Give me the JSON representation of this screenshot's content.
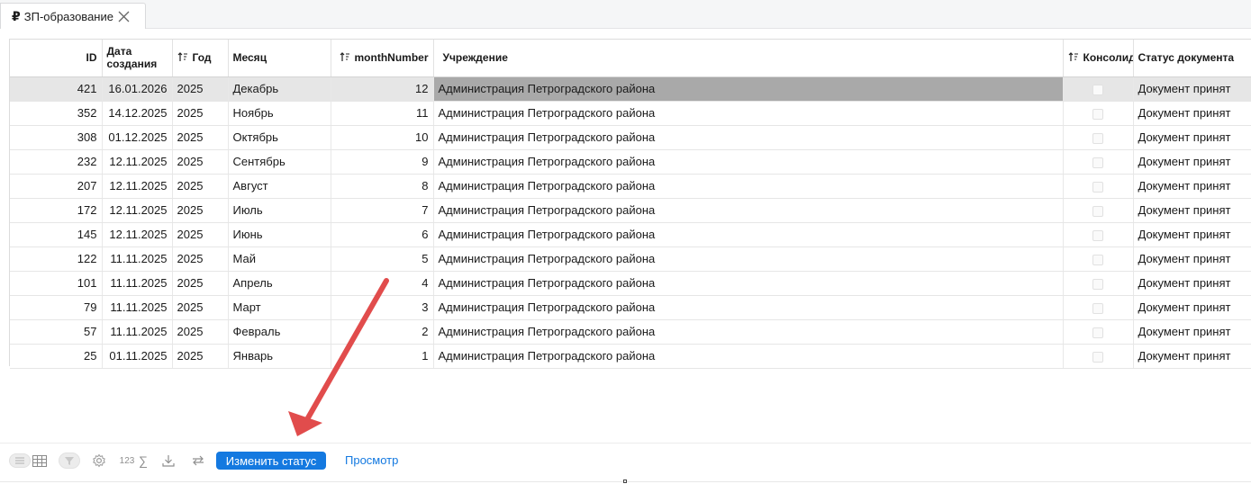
{
  "tab": {
    "currency_symbol": "₽",
    "title": "ЗП-образование"
  },
  "columns": {
    "id": "ID",
    "created": "Дата создания",
    "year": "Год",
    "month": "Месяц",
    "month_number": "monthNumber",
    "institution": "Учреждение",
    "consolidated": "Консолид",
    "doc_status": "Статус документа"
  },
  "rows": [
    {
      "id": "421",
      "created": "16.01.2026",
      "year": "2025",
      "month": "Декабрь",
      "month_number": "12",
      "institution": "Администрация Петроградского района",
      "status": "Документ принят"
    },
    {
      "id": "352",
      "created": "14.12.2025",
      "year": "2025",
      "month": "Ноябрь",
      "month_number": "11",
      "institution": "Администрация Петроградского района",
      "status": "Документ принят"
    },
    {
      "id": "308",
      "created": "01.12.2025",
      "year": "2025",
      "month": "Октябрь",
      "month_number": "10",
      "institution": "Администрация Петроградского района",
      "status": "Документ принят"
    },
    {
      "id": "232",
      "created": "12.11.2025",
      "year": "2025",
      "month": "Сентябрь",
      "month_number": "9",
      "institution": "Администрация Петроградского района",
      "status": "Документ принят"
    },
    {
      "id": "207",
      "created": "12.11.2025",
      "year": "2025",
      "month": "Август",
      "month_number": "8",
      "institution": "Администрация Петроградского района",
      "status": "Документ принят"
    },
    {
      "id": "172",
      "created": "12.11.2025",
      "year": "2025",
      "month": "Июль",
      "month_number": "7",
      "institution": "Администрация Петроградского района",
      "status": "Документ принят"
    },
    {
      "id": "145",
      "created": "12.11.2025",
      "year": "2025",
      "month": "Июнь",
      "month_number": "6",
      "institution": "Администрация Петроградского района",
      "status": "Документ принят"
    },
    {
      "id": "122",
      "created": "11.11.2025",
      "year": "2025",
      "month": "Май",
      "month_number": "5",
      "institution": "Администрация Петроградского района",
      "status": "Документ принят"
    },
    {
      "id": "101",
      "created": "11.11.2025",
      "year": "2025",
      "month": "Апрель",
      "month_number": "4",
      "institution": "Администрация Петроградского района",
      "status": "Документ принят"
    },
    {
      "id": "79",
      "created": "11.11.2025",
      "year": "2025",
      "month": "Март",
      "month_number": "3",
      "institution": "Администрация Петроградского района",
      "status": "Документ принят"
    },
    {
      "id": "57",
      "created": "11.11.2025",
      "year": "2025",
      "month": "Февраль",
      "month_number": "2",
      "institution": "Администрация Петроградского района",
      "status": "Документ принят"
    },
    {
      "id": "25",
      "created": "01.11.2025",
      "year": "2025",
      "month": "Январь",
      "month_number": "1",
      "institution": "Администрация Петроградского района",
      "status": "Документ принят"
    }
  ],
  "toolbar": {
    "numeric_label": "123",
    "sum_symbol": "∑",
    "change_status_label": "Изменить статус",
    "view_label": "Просмотр"
  },
  "icons": {
    "tab_close": "close-icon",
    "sort": "sort-ascending-icon",
    "view_toggle": "list-view-icon",
    "grid": "grid-icon",
    "filter": "filter-icon",
    "settings": "gear-icon",
    "download": "download-icon",
    "refresh": "refresh-icon"
  },
  "colors": {
    "primary": "#1479e0",
    "selected_row": "#e6e6e6",
    "focused_cell": "#a9a9a9",
    "annotation_arrow": "#e14c4c"
  }
}
